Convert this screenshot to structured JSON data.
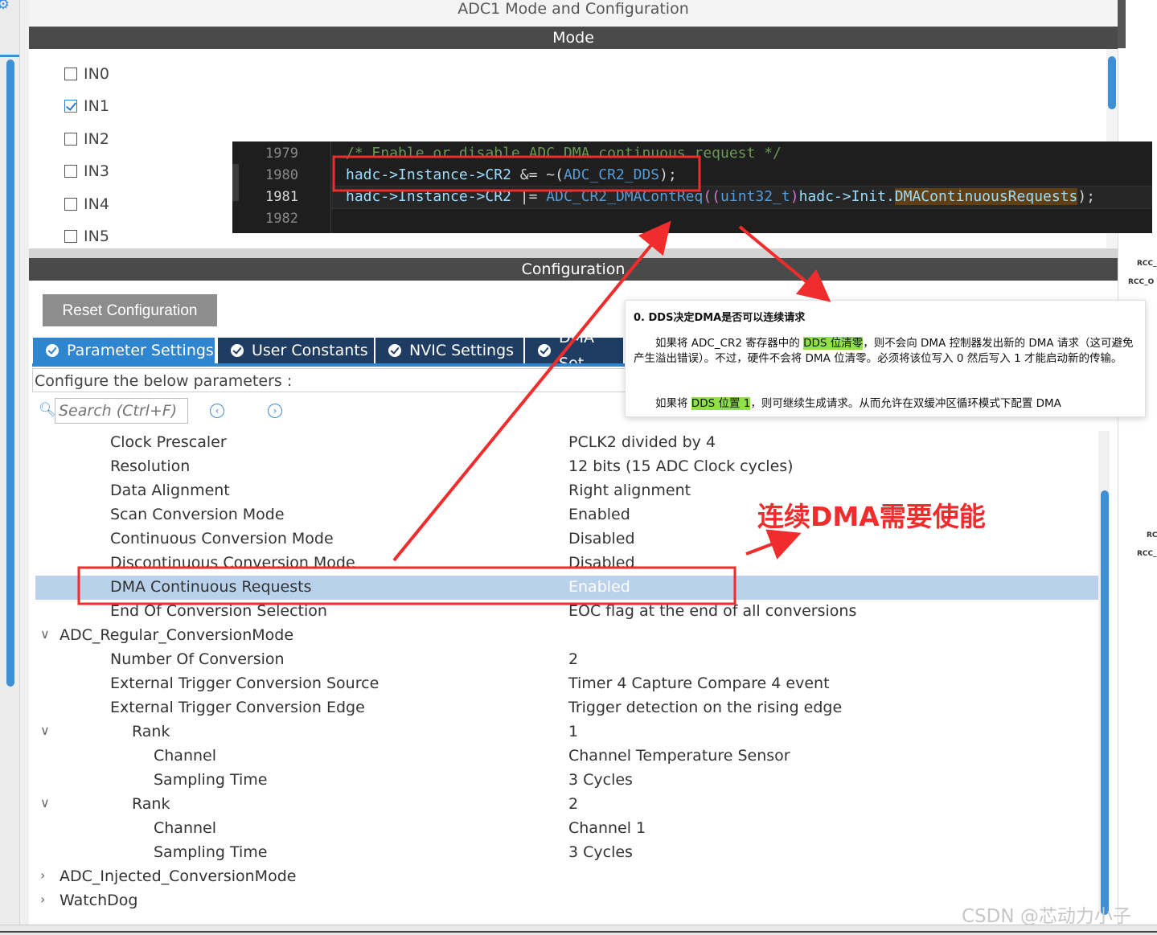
{
  "window": {
    "title": "ADC1 Mode and Configuration"
  },
  "mode": {
    "header": "Mode",
    "channels": [
      {
        "label": "IN0",
        "checked": false
      },
      {
        "label": "IN1",
        "checked": true
      },
      {
        "label": "IN2",
        "checked": false
      },
      {
        "label": "IN3",
        "checked": false
      },
      {
        "label": "IN4",
        "checked": false
      },
      {
        "label": "IN5",
        "checked": false
      }
    ]
  },
  "configuration": {
    "header": "Configuration",
    "reset_label": "Reset Configuration",
    "tabs": [
      {
        "label": "Parameter Settings",
        "active": true
      },
      {
        "label": "User Constants",
        "active": false
      },
      {
        "label": "NVIC Settings",
        "active": false
      },
      {
        "label": "DMA Set",
        "active": false
      }
    ],
    "hint": "Configure the below parameters :",
    "search_placeholder": "Search (Ctrl+F)",
    "params": [
      {
        "name": "Clock Prescaler",
        "value": "PCLK2 divided by 4",
        "indent": 93
      },
      {
        "name": "Resolution",
        "value": "12 bits (15 ADC Clock cycles)",
        "indent": 93
      },
      {
        "name": "Data Alignment",
        "value": "Right alignment",
        "indent": 93
      },
      {
        "name": "Scan Conversion Mode",
        "value": "Enabled",
        "indent": 93
      },
      {
        "name": "Continuous Conversion Mode",
        "value": "Disabled",
        "indent": 93
      },
      {
        "name": "Discontinuous Conversion Mode",
        "value": "Disabled",
        "indent": 93
      },
      {
        "name": "DMA Continuous Requests",
        "value": "Enabled",
        "indent": 93,
        "selected": true
      },
      {
        "name": "End Of Conversion Selection",
        "value": "EOC flag at the end of all conversions",
        "indent": 93
      },
      {
        "name": "ADC_Regular_ConversionMode",
        "value": "",
        "indent": 30,
        "chevron": "expanded"
      },
      {
        "name": "Number Of Conversion",
        "value": "2",
        "indent": 93
      },
      {
        "name": "External Trigger Conversion Source",
        "value": "Timer 4 Capture Compare 4 event",
        "indent": 93
      },
      {
        "name": "External Trigger Conversion Edge",
        "value": "Trigger detection on the rising edge",
        "indent": 93
      },
      {
        "name": "Rank",
        "value": "1",
        "indent": 120,
        "chevron": "expanded"
      },
      {
        "name": "Channel",
        "value": "Channel Temperature Sensor",
        "indent": 147
      },
      {
        "name": "Sampling Time",
        "value": "3 Cycles",
        "indent": 147
      },
      {
        "name": "Rank",
        "value": "2",
        "indent": 120,
        "chevron": "expanded"
      },
      {
        "name": "Channel",
        "value": "Channel 1",
        "indent": 147
      },
      {
        "name": "Sampling Time",
        "value": "3 Cycles",
        "indent": 147
      },
      {
        "name": "ADC_Injected_ConversionMode",
        "value": "",
        "indent": 30,
        "chevron": "collapsed"
      },
      {
        "name": "WatchDog",
        "value": "",
        "indent": 30,
        "chevron": "collapsed"
      }
    ]
  },
  "code": {
    "line_numbers": [
      "1979",
      "1980",
      "1981",
      "1982"
    ],
    "line1979": "/* Enable or disable ADC DMA continuous request */",
    "line1980": {
      "a": "hadc->Instance->CR2",
      "b": " &= ~(",
      "c": "ADC_CR2_DDS",
      "d": ");"
    },
    "line1981": {
      "a": "hadc->Instance->CR2",
      "b": " |= ",
      "c": "ADC_CR2_DMAContReq",
      "d": "((",
      "e": "uint32_t",
      "f": ")",
      "g": "hadc->Init.",
      "h": "DMAContinuousRequests",
      "i": ");"
    }
  },
  "doc": {
    "heading": "0. DDS决定DMA是否可以连续请求",
    "p1_a": "如果将 ADC_CR2 寄存器中的 ",
    "p1_hl": "DDS 位清零",
    "p1_b": "，则不会向 DMA 控制器发出新的 DMA 请求（这可避免产生溢出错误）。不过，硬件不会将 DMA 位清零。必须将该位写入 0 然后写入 1 才能启动新的传输。",
    "p2_a": "如果将 ",
    "p2_hl": "DDS 位置 1",
    "p2_b": "，则可继续生成请求。从而允许在双缓冲区循环模式下配置 DMA"
  },
  "annotation": {
    "text": "连续DMA需要使能"
  },
  "watermark": "CSDN @芯动力小子",
  "right_labels": [
    "RCC_",
    "RCC_O",
    "RC",
    "RCC_"
  ],
  "colors": {
    "accent": "#2f86d0",
    "tab_dark": "#1f3d63",
    "selection": "#b9d1ea",
    "annotation": "#f02c2c"
  }
}
